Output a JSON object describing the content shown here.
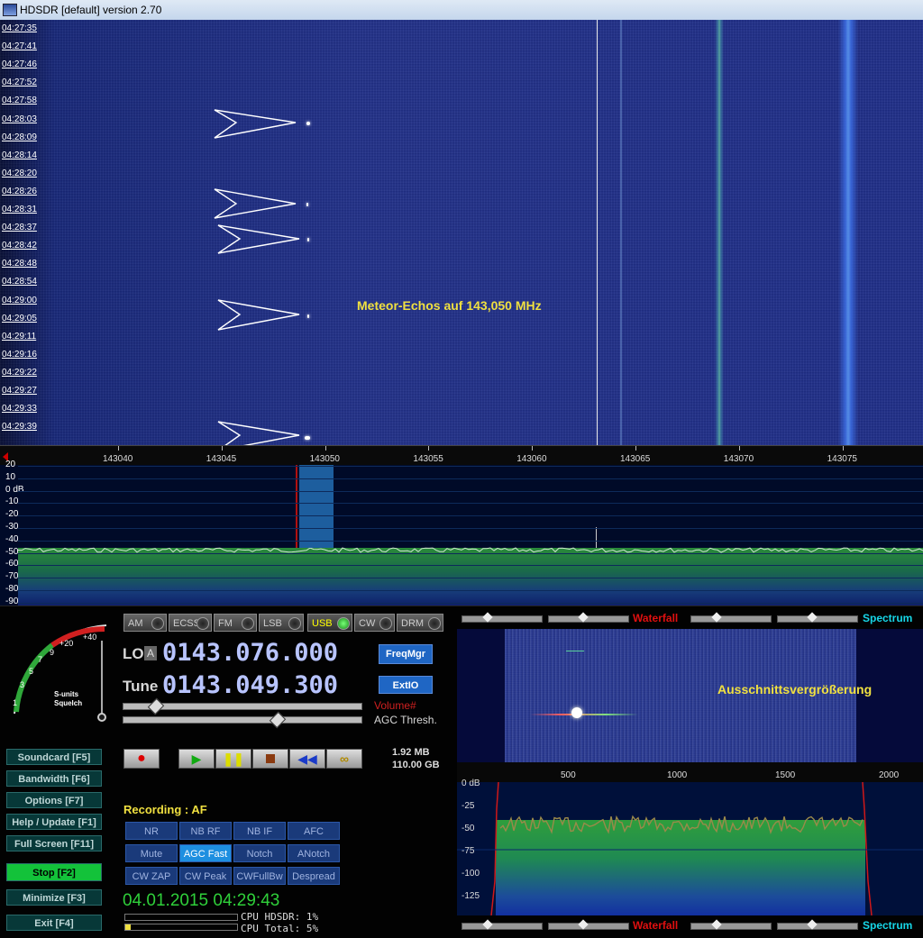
{
  "window": {
    "title": "HDSDR [default]  version 2.70"
  },
  "waterfall": {
    "times": [
      "04:27:35",
      "04:27:41",
      "04:27:46",
      "04:27:52",
      "04:27:58",
      "04:28:03",
      "04:28:09",
      "04:28:14",
      "04:28:20",
      "04:28:26",
      "04:28:31",
      "04:28:37",
      "04:28:42",
      "04:28:48",
      "04:28:54",
      "04:29:00",
      "04:29:05",
      "04:29:11",
      "04:29:16",
      "04:29:22",
      "04:29:27",
      "04:29:33",
      "04:29:39"
    ],
    "annotation": "Meteor-Echos auf 143,050 MHz"
  },
  "frequency_scale": [
    "143040",
    "143045",
    "143050",
    "143055",
    "143060",
    "143065",
    "143070",
    "143075"
  ],
  "spectrum": {
    "db_labels": [
      "20",
      "10",
      "0 dB",
      "-10",
      "-20",
      "-30",
      "-40",
      "-50",
      "-60",
      "-70",
      "-80",
      "-90"
    ]
  },
  "modes": [
    {
      "label": "AM",
      "active": false
    },
    {
      "label": "ECSS",
      "active": false
    },
    {
      "label": "FM",
      "active": false
    },
    {
      "label": "LSB",
      "active": false
    },
    {
      "label": "USB",
      "active": true
    },
    {
      "label": "CW",
      "active": false
    },
    {
      "label": "DRM",
      "active": false
    }
  ],
  "smeter": {
    "labels": [
      "1",
      "3",
      "5",
      "7",
      "9",
      "+20",
      "+40"
    ],
    "title_line1": "S-units",
    "title_line2": "Squelch"
  },
  "lo": {
    "label": "LO",
    "badge": "A",
    "value": "0143.076.000"
  },
  "tune": {
    "label": "Tune",
    "value": "0143.049.300"
  },
  "buttons": {
    "freqmgr": "FreqMgr",
    "extio": "ExtIO"
  },
  "volume_label": "Volume#",
  "agc_label": "AGC Thresh.",
  "left_buttons": [
    {
      "label": "Soundcard  [F5]"
    },
    {
      "label": "Bandwidth  [F6]"
    },
    {
      "label": "Options   [F7]"
    },
    {
      "label": "Help / Update  [F1]"
    },
    {
      "label": "Full Screen  [F11]"
    },
    {
      "label": "Stop        [F2]"
    },
    {
      "label": "Minimize  [F3]"
    },
    {
      "label": "Exit       [F4]"
    }
  ],
  "recording": {
    "size": "1.92 MB",
    "free": "110.00 GB",
    "label": "Recording : AF"
  },
  "dsp_buttons": [
    [
      "NR",
      "NB RF",
      "NB IF",
      "AFC"
    ],
    [
      "Mute",
      "AGC Fast",
      "Notch",
      "ANotch"
    ],
    [
      "CW ZAP",
      "CW Peak",
      "CWFullBw",
      "Despread"
    ]
  ],
  "datetime": "04.01.2015 04:29:43",
  "cpu": {
    "hdsdr": "CPU HDSDR:  1%",
    "total": "CPU Total:  5%"
  },
  "zoom": {
    "waterfall_label": "Waterfall",
    "spectrum_label": "Spectrum",
    "annotation": "Ausschnittsvergrößerung",
    "scale": [
      "500",
      "1000",
      "1500",
      "2000"
    ],
    "db_labels": [
      "0 dB",
      "-25",
      "-50",
      "-75",
      "-100",
      "-125"
    ]
  },
  "colors": {
    "accent_yellow": "#f0e040",
    "waterfall_red": "#e01010",
    "spectrum_cyan": "#17d7e8",
    "lcd": "#b8c4ff"
  }
}
